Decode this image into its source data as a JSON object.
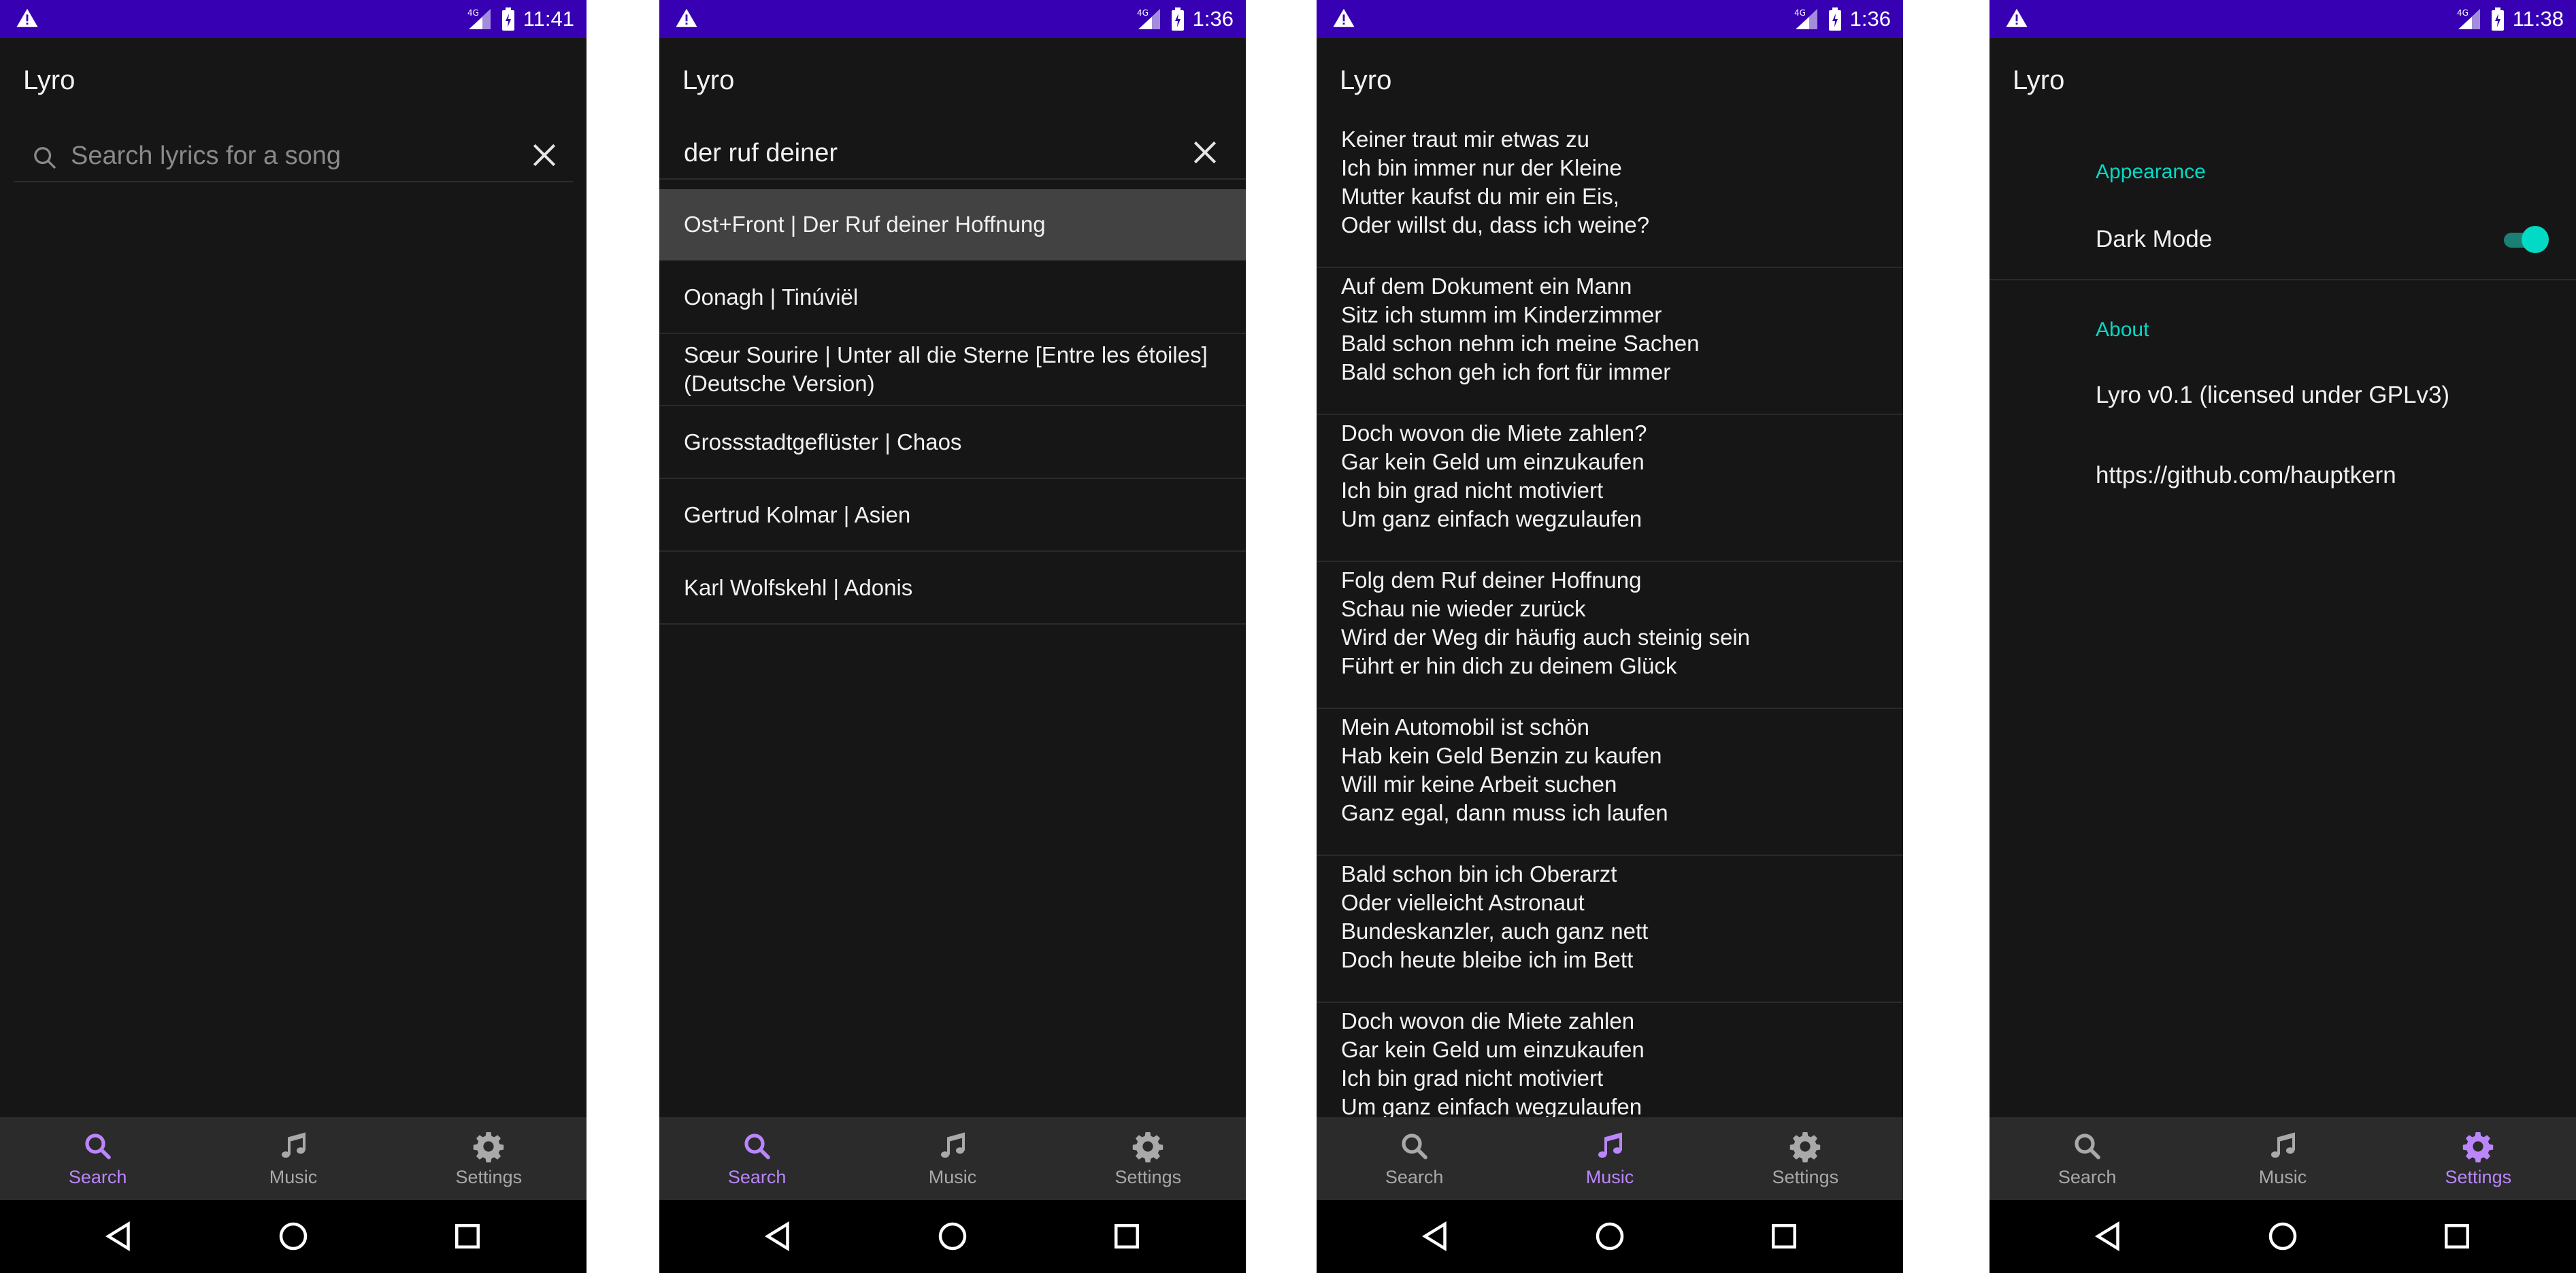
{
  "app_name": "Lyro",
  "colors": {
    "primary": "#3700b3",
    "accent": "#bb86fc",
    "teal": "#03dac5",
    "background": "#161616",
    "nav": "#2b2b2b"
  },
  "nav": {
    "search": "Search",
    "music": "Music",
    "settings": "Settings"
  },
  "screens": [
    {
      "status_time": "11:41",
      "search": {
        "value": "",
        "placeholder": "Search lyrics for a song"
      }
    },
    {
      "status_time": "1:36",
      "search": {
        "value": "der ruf deiner",
        "placeholder": "Search lyrics for a song"
      },
      "results": [
        "Ost+Front | Der Ruf deiner Hoffnung",
        "Oonagh | Tinúviël",
        "Sœur Sourire | Unter all die Sterne [Entre les étoiles] (Deutsche Version)",
        "Grossstadtgeflüster | Chaos",
        "Gertrud Kolmar | Asien",
        "Karl Wolfskehl | Adonis"
      ]
    },
    {
      "status_time": "1:36",
      "stanzas": [
        [
          "Keiner traut mir etwas zu",
          "Ich bin immer nur der Kleine",
          "Mutter kaufst du mir ein Eis,",
          "Oder willst du, dass ich weine?"
        ],
        [
          "Auf dem Dokument ein Mann",
          "Sitz ich stumm im Kinderzimmer",
          "Bald schon nehm ich meine Sachen",
          "Bald schon geh ich fort für immer"
        ],
        [
          "Doch wovon die Miete zahlen?",
          "Gar kein Geld um einzukaufen",
          "Ich bin grad nicht motiviert",
          "Um ganz einfach wegzulaufen"
        ],
        [
          "Folg dem Ruf deiner Hoffnung",
          "Schau nie wieder zurück",
          "Wird der Weg dir häufig auch steinig sein",
          "Führt er hin dich zu deinem Glück"
        ],
        [
          "Mein Automobil ist schön",
          "Hab kein Geld Benzin zu kaufen",
          "Will mir keine Arbeit suchen",
          "Ganz egal, dann muss ich laufen"
        ],
        [
          "Bald schon bin ich Oberarzt",
          "Oder vielleicht Astronaut",
          "Bundeskanzler, auch ganz nett",
          "Doch heute bleibe ich im Bett"
        ],
        [
          "Doch wovon die Miete zahlen",
          "Gar kein Geld um einzukaufen",
          "Ich bin grad nicht motiviert",
          "Um ganz einfach wegzulaufen"
        ]
      ]
    },
    {
      "status_time": "11:38",
      "settings": {
        "appearance_header": "Appearance",
        "dark_mode_label": "Dark Mode",
        "dark_mode_on": true,
        "about_header": "About",
        "version": "Lyro v0.1 (licensed under GPLv3)",
        "link": "https://github.com/hauptkern"
      }
    }
  ]
}
